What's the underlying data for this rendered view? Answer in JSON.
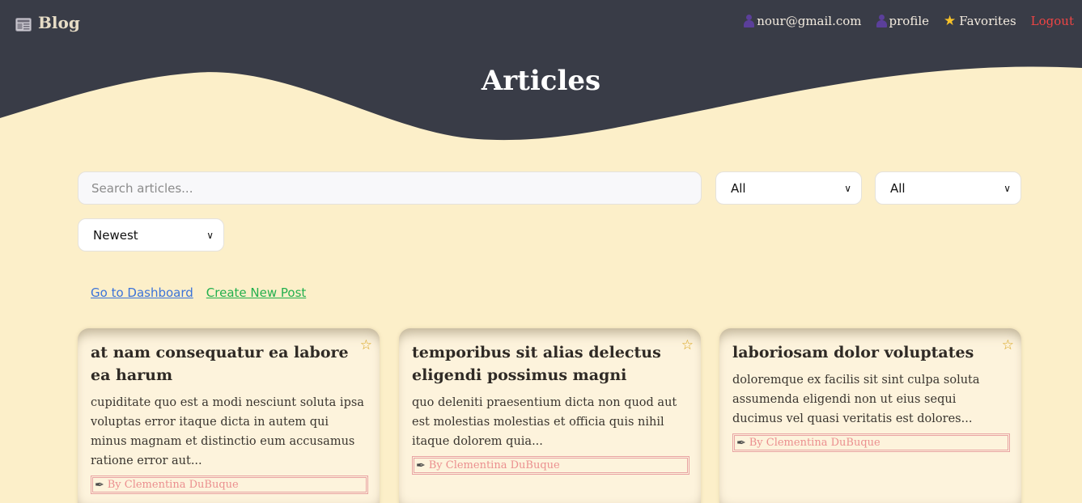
{
  "nav": {
    "brand": "Blog",
    "user_email": "nour@gmail.com",
    "profile": "profile",
    "favorites": "Favorites",
    "logout": "Logout"
  },
  "page": {
    "title": "Articles"
  },
  "colors": {
    "header_bg": "#393c47",
    "page_bg": "#fcefc9",
    "logout": "#ef4444"
  },
  "filters": {
    "search_placeholder": "Search articles...",
    "select_1": "All",
    "select_2": "All",
    "sort": "Newest"
  },
  "links": {
    "dashboard": "Go to Dashboard",
    "create": "Create New Post"
  },
  "cards": [
    {
      "title": "at nam consequatur ea labore ea harum",
      "body": "cupiditate quo est a modi nesciunt soluta ipsa voluptas error itaque dicta in autem qui minus magnam et distinctio eum accusamus ratione error aut...",
      "author": "By Clementina DuBuque"
    },
    {
      "title": "temporibus sit alias delectus eligendi possimus magni",
      "body": "quo deleniti praesentium dicta non quod aut est molestias molestias et officia quis nihil itaque dolorem quia...",
      "author": "By Clementina DuBuque"
    },
    {
      "title": "laboriosam dolor voluptates",
      "body": "doloremque ex facilis sit sint culpa soluta assumenda eligendi non ut eius sequi ducimus vel quasi veritatis est dolores...",
      "author": "By Clementina DuBuque"
    }
  ]
}
